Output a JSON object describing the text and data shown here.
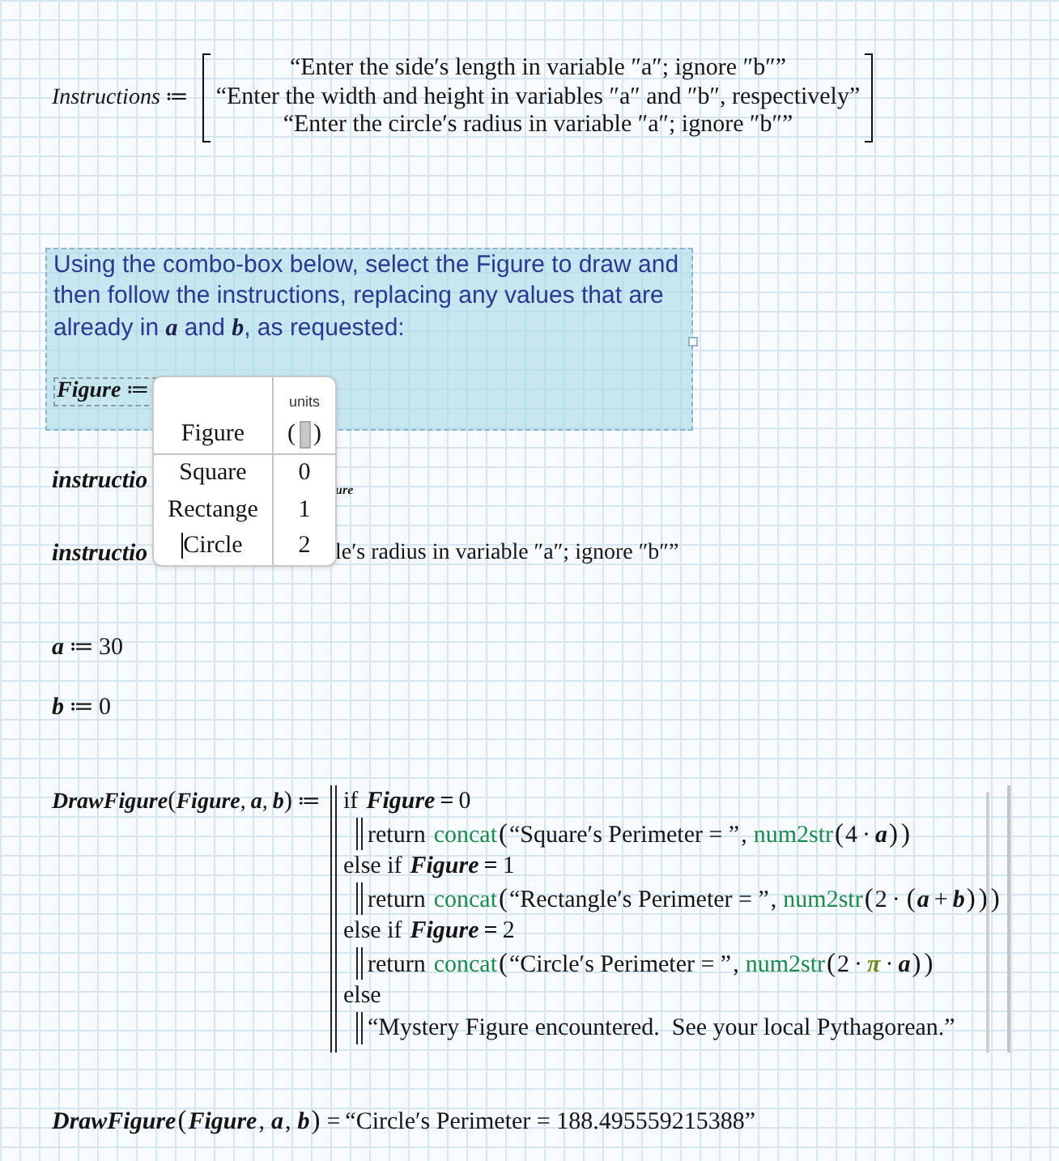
{
  "instructions_definition": {
    "tokens": [
      {
        "kind": "var",
        "text": "Instructions"
      },
      {
        "kind": "op",
        "text": "≔"
      }
    ],
    "rows": [
      "“Enter the side′s length in variable ″a″; ignore ″b″”",
      "“Enter the width and height in variables ″a″ and ″b″, respectively”",
      "“Enter the circle′s radius in variable ″a″; ignore ″b″”"
    ]
  },
  "text_region": {
    "text": "Using the combo-box below, select the Figure to draw and then follow the instructions, replacing any values that are already in **a** and **b**, as requested:",
    "definition": [
      {
        "kind": "var",
        "text": "Figure"
      },
      {
        "kind": "op",
        "text": "≔"
      }
    ]
  },
  "combo_box": {
    "header": "Figure",
    "units_label": "units",
    "units_delimiters": [
      "(",
      ")"
    ],
    "options": [
      {
        "label": "Square",
        "value": "0",
        "selected": false
      },
      {
        "label": "Rectange",
        "value": "1",
        "selected": false
      },
      {
        "label": "Circle",
        "value": "2",
        "selected": true
      }
    ]
  },
  "hidden_lines": [
    {
      "tokens": [
        {
          "kind": "var",
          "text": "instructio"
        }
      ],
      "kind": "subscript",
      "fragment": "ure"
    },
    {
      "tokens": [
        {
          "kind": "var",
          "text": "instructio"
        }
      ],
      "kind": "text",
      "fragment": "le′s radius in variable ″a″; ignore ″b″”"
    }
  ],
  "assignments": [
    [
      {
        "kind": "var",
        "text": "a"
      },
      {
        "kind": "op",
        "text": "≔"
      },
      {
        "kind": "num",
        "text": "30"
      }
    ],
    [
      {
        "kind": "var",
        "text": "b"
      },
      {
        "kind": "op",
        "text": "≔"
      },
      {
        "kind": "num",
        "text": "0"
      }
    ]
  ],
  "function_definition": {
    "tokens": [
      {
        "kind": "var",
        "text": "DrawFigure"
      },
      {
        "kind": "paren",
        "text": "("
      },
      {
        "kind": "var",
        "text": "Figure"
      },
      {
        "kind": "sep",
        "text": ","
      },
      {
        "kind": "var",
        "text": "a"
      },
      {
        "kind": "sep",
        "text": ","
      },
      {
        "kind": "var",
        "text": "b"
      },
      {
        "kind": "paren",
        "text": ")"
      },
      {
        "kind": "op",
        "text": "≔"
      }
    ],
    "branches": [
      {
        "line": [
          {
            "kind": "kw",
            "text": "if"
          },
          {
            "kind": "var",
            "text": "Figure"
          },
          {
            "kind": "bool",
            "text": "="
          },
          {
            "kind": "num",
            "text": "0"
          }
        ],
        "body": [
          {
            "kind": "kw",
            "text": "return"
          },
          {
            "kind": "fn",
            "text": "concat"
          },
          {
            "kind": "paren",
            "text": "("
          },
          {
            "kind": "str",
            "text": "“Square′s Perimeter = ”"
          },
          {
            "kind": "sep",
            "text": ","
          },
          {
            "kind": "fn",
            "text": "num2str"
          },
          {
            "kind": "paren",
            "text": "("
          },
          {
            "kind": "num",
            "text": "4"
          },
          {
            "kind": "op",
            "text": "·"
          },
          {
            "kind": "var",
            "text": "a"
          },
          {
            "kind": "paren",
            "text": ")"
          },
          {
            "kind": "paren",
            "text": ")"
          }
        ]
      },
      {
        "line": [
          {
            "kind": "kw",
            "text": "else if"
          },
          {
            "kind": "var",
            "text": "Figure"
          },
          {
            "kind": "bool",
            "text": "="
          },
          {
            "kind": "num",
            "text": "1"
          }
        ],
        "body": [
          {
            "kind": "kw",
            "text": "return"
          },
          {
            "kind": "fn",
            "text": "concat"
          },
          {
            "kind": "paren",
            "text": "("
          },
          {
            "kind": "str",
            "text": "“Rectangle′s Perimeter = ”"
          },
          {
            "kind": "sep",
            "text": ","
          },
          {
            "kind": "fn",
            "text": "num2str"
          },
          {
            "kind": "paren",
            "text": "("
          },
          {
            "kind": "num",
            "text": "2"
          },
          {
            "kind": "op",
            "text": "·"
          },
          {
            "kind": "paren",
            "text": "("
          },
          {
            "kind": "var",
            "text": "a"
          },
          {
            "kind": "op",
            "text": "+"
          },
          {
            "kind": "var",
            "text": "b"
          },
          {
            "kind": "paren",
            "text": ")"
          },
          {
            "kind": "paren",
            "text": ")"
          },
          {
            "kind": "paren",
            "text": ")"
          }
        ]
      },
      {
        "line": [
          {
            "kind": "kw",
            "text": "else if"
          },
          {
            "kind": "var",
            "text": "Figure"
          },
          {
            "kind": "bool",
            "text": "="
          },
          {
            "kind": "num",
            "text": "2"
          }
        ],
        "body": [
          {
            "kind": "kw",
            "text": "return"
          },
          {
            "kind": "fn",
            "text": "concat"
          },
          {
            "kind": "paren",
            "text": "("
          },
          {
            "kind": "str",
            "text": "“Circle′s Perimeter = ”"
          },
          {
            "kind": "sep",
            "text": ","
          },
          {
            "kind": "fn",
            "text": "num2str"
          },
          {
            "kind": "paren",
            "text": "("
          },
          {
            "kind": "num",
            "text": "2"
          },
          {
            "kind": "op",
            "text": "·"
          },
          {
            "kind": "const",
            "text": "π"
          },
          {
            "kind": "op",
            "text": "·"
          },
          {
            "kind": "var",
            "text": "a"
          },
          {
            "kind": "paren",
            "text": ")"
          },
          {
            "kind": "paren",
            "text": ")"
          }
        ]
      },
      {
        "line": [
          {
            "kind": "kw",
            "text": "else"
          }
        ],
        "body": [
          {
            "kind": "str",
            "text": "“Mystery Figure encountered.  See your local Pythagorean.”"
          }
        ]
      }
    ]
  },
  "result": [
    {
      "kind": "var",
      "text": "DrawFigure"
    },
    {
      "kind": "paren",
      "text": "("
    },
    {
      "kind": "var",
      "text": "Figure"
    },
    {
      "kind": "sep",
      "text": ","
    },
    {
      "kind": "var",
      "text": "a"
    },
    {
      "kind": "sep",
      "text": ","
    },
    {
      "kind": "var",
      "text": "b"
    },
    {
      "kind": "paren",
      "text": ")"
    },
    {
      "kind": "op",
      "text": "="
    },
    {
      "kind": "str",
      "text": "“Circle′s Perimeter = 188.495559215388”"
    }
  ]
}
